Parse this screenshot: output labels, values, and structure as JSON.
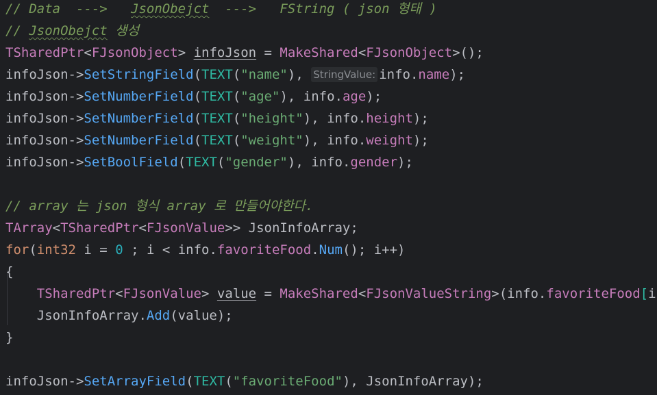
{
  "theme": {
    "background": "#1e1f22",
    "colors": {
      "default": "#bcbec4",
      "comment": "#7a9c5a",
      "type": "#c77dbb",
      "keyword": "#cf8e6d",
      "function": "#56a8f5",
      "macro": "#2fbaa3",
      "string": "#6aab73",
      "number": "#2aacb8",
      "field": "#c77dbb",
      "korean": "#7a9c5a",
      "hint": "#8c8f94"
    }
  },
  "code": {
    "lines": [
      {
        "tokens": [
          {
            "t": "// Data  --->   ",
            "c": "comment"
          },
          {
            "t": "JsonObejct",
            "c": "comment",
            "s": "squiggle"
          },
          {
            "t": "  --->   FString ( json 형태 )",
            "c": "comment"
          }
        ]
      },
      {
        "tokens": [
          {
            "t": "// ",
            "c": "comment"
          },
          {
            "t": "JsonObejct",
            "c": "comment",
            "s": "squiggle"
          },
          {
            "t": " 생성",
            "c": "comment"
          }
        ]
      },
      {
        "tokens": [
          {
            "t": "TSharedPtr",
            "c": "type"
          },
          {
            "t": "<",
            "c": "default"
          },
          {
            "t": "FJsonObject",
            "c": "type"
          },
          {
            "t": "> ",
            "c": "default"
          },
          {
            "t": "infoJson",
            "c": "default",
            "s": "underline"
          },
          {
            "t": " = ",
            "c": "default"
          },
          {
            "t": "MakeShared",
            "c": "type"
          },
          {
            "t": "<",
            "c": "default"
          },
          {
            "t": "FJsonObject",
            "c": "type"
          },
          {
            "t": ">();",
            "c": "default"
          }
        ]
      },
      {
        "tokens": [
          {
            "t": "infoJson",
            "c": "default"
          },
          {
            "t": "->",
            "c": "default"
          },
          {
            "t": "SetStringField",
            "c": "function"
          },
          {
            "t": "(",
            "c": "default"
          },
          {
            "t": "TEXT",
            "c": "macro"
          },
          {
            "t": "(",
            "c": "default"
          },
          {
            "t": "\"name\"",
            "c": "string"
          },
          {
            "t": "), ",
            "c": "default"
          },
          {
            "h": "StringValue:"
          },
          {
            "t": "info.",
            "c": "default"
          },
          {
            "t": "name",
            "c": "field"
          },
          {
            "t": ");",
            "c": "default"
          }
        ]
      },
      {
        "tokens": [
          {
            "t": "infoJson",
            "c": "default"
          },
          {
            "t": "->",
            "c": "default"
          },
          {
            "t": "SetNumberField",
            "c": "function"
          },
          {
            "t": "(",
            "c": "default"
          },
          {
            "t": "TEXT",
            "c": "macro"
          },
          {
            "t": "(",
            "c": "default"
          },
          {
            "t": "\"age\"",
            "c": "string"
          },
          {
            "t": "), info.",
            "c": "default"
          },
          {
            "t": "age",
            "c": "field"
          },
          {
            "t": ");",
            "c": "default"
          }
        ]
      },
      {
        "tokens": [
          {
            "t": "infoJson",
            "c": "default"
          },
          {
            "t": "->",
            "c": "default"
          },
          {
            "t": "SetNumberField",
            "c": "function"
          },
          {
            "t": "(",
            "c": "default"
          },
          {
            "t": "TEXT",
            "c": "macro"
          },
          {
            "t": "(",
            "c": "default"
          },
          {
            "t": "\"height\"",
            "c": "string"
          },
          {
            "t": "), info.",
            "c": "default"
          },
          {
            "t": "height",
            "c": "field"
          },
          {
            "t": ");",
            "c": "default"
          }
        ]
      },
      {
        "tokens": [
          {
            "t": "infoJson",
            "c": "default"
          },
          {
            "t": "->",
            "c": "default"
          },
          {
            "t": "SetNumberField",
            "c": "function"
          },
          {
            "t": "(",
            "c": "default"
          },
          {
            "t": "TEXT",
            "c": "macro"
          },
          {
            "t": "(",
            "c": "default"
          },
          {
            "t": "\"weight\"",
            "c": "string"
          },
          {
            "t": "), info.",
            "c": "default"
          },
          {
            "t": "weight",
            "c": "field"
          },
          {
            "t": ");",
            "c": "default"
          }
        ]
      },
      {
        "tokens": [
          {
            "t": "infoJson",
            "c": "default"
          },
          {
            "t": "->",
            "c": "default"
          },
          {
            "t": "SetBoolField",
            "c": "function"
          },
          {
            "t": "(",
            "c": "default"
          },
          {
            "t": "TEXT",
            "c": "macro"
          },
          {
            "t": "(",
            "c": "default"
          },
          {
            "t": "\"gender\"",
            "c": "string"
          },
          {
            "t": "), info.",
            "c": "default"
          },
          {
            "t": "gender",
            "c": "field"
          },
          {
            "t": ");",
            "c": "default"
          }
        ]
      },
      {
        "tokens": []
      },
      {
        "tokens": [
          {
            "t": "// array 는 json 형식 array 로 만들어야한다.",
            "c": "comment"
          }
        ]
      },
      {
        "tokens": [
          {
            "t": "TArray",
            "c": "type"
          },
          {
            "t": "<",
            "c": "default"
          },
          {
            "t": "TSharedPtr",
            "c": "type"
          },
          {
            "t": "<",
            "c": "default"
          },
          {
            "t": "FJsonValue",
            "c": "type"
          },
          {
            "t": ">> JsonInfoArray;",
            "c": "default"
          }
        ]
      },
      {
        "tokens": [
          {
            "t": "for",
            "c": "keyword"
          },
          {
            "t": "(",
            "c": "default"
          },
          {
            "t": "int32",
            "c": "keyword"
          },
          {
            "t": " i = ",
            "c": "default"
          },
          {
            "t": "0",
            "c": "number"
          },
          {
            "t": " ; i < info.",
            "c": "default"
          },
          {
            "t": "favoriteFood",
            "c": "field"
          },
          {
            "t": ".",
            "c": "default"
          },
          {
            "t": "Num",
            "c": "function"
          },
          {
            "t": "(); i++)",
            "c": "default"
          }
        ]
      },
      {
        "tokens": [
          {
            "t": "{",
            "c": "default"
          }
        ]
      },
      {
        "tokens": [
          {
            "t": "    ",
            "c": "default"
          },
          {
            "t": "TSharedPtr",
            "c": "type"
          },
          {
            "t": "<",
            "c": "default"
          },
          {
            "t": "FJsonValue",
            "c": "type"
          },
          {
            "t": "> ",
            "c": "default"
          },
          {
            "t": "value",
            "c": "default",
            "s": "underline"
          },
          {
            "t": " = ",
            "c": "default"
          },
          {
            "t": "MakeShared",
            "c": "type"
          },
          {
            "t": "<",
            "c": "default"
          },
          {
            "t": "FJsonValueString",
            "c": "type"
          },
          {
            "t": ">(info.",
            "c": "default"
          },
          {
            "t": "favoriteFood",
            "c": "field"
          },
          {
            "t": "[",
            "c": "macro"
          },
          {
            "t": "i",
            "c": "default"
          },
          {
            "t": "]",
            "c": "macro"
          },
          {
            "t": ");",
            "c": "default"
          }
        ]
      },
      {
        "tokens": [
          {
            "t": "    JsonInfoArray.",
            "c": "default"
          },
          {
            "t": "Add",
            "c": "function"
          },
          {
            "t": "(value);",
            "c": "default"
          }
        ]
      },
      {
        "tokens": [
          {
            "t": "}",
            "c": "default"
          }
        ]
      },
      {
        "tokens": []
      },
      {
        "tokens": [
          {
            "t": "infoJson",
            "c": "default"
          },
          {
            "t": "->",
            "c": "default"
          },
          {
            "t": "SetArrayField",
            "c": "function"
          },
          {
            "t": "(",
            "c": "default"
          },
          {
            "t": "TEXT",
            "c": "macro"
          },
          {
            "t": "(",
            "c": "default"
          },
          {
            "t": "\"favoriteFood\"",
            "c": "string"
          },
          {
            "t": "), JsonInfoArray);",
            "c": "default"
          }
        ]
      }
    ]
  }
}
